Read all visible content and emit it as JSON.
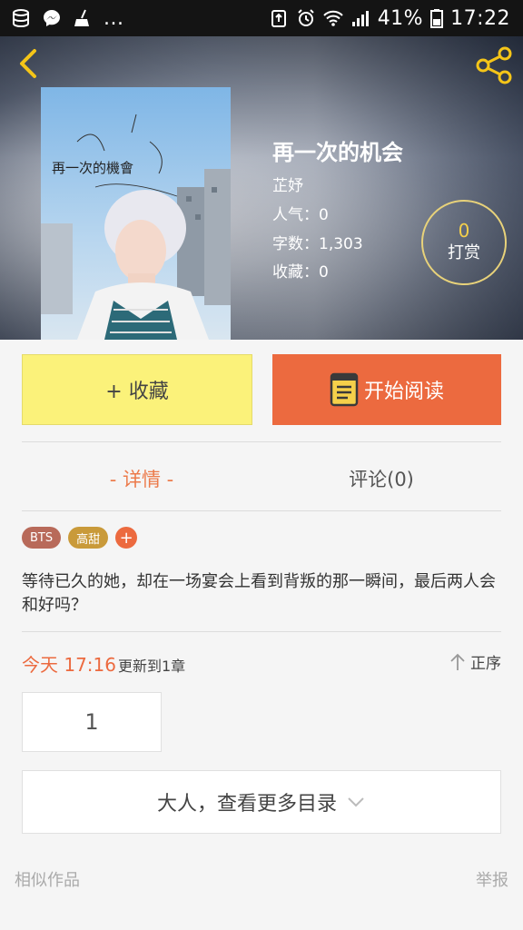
{
  "status_bar": {
    "left_extra": "...",
    "battery_percent": "41%",
    "time": "17:22"
  },
  "book": {
    "title": "再一次的机会",
    "author": "芷妤",
    "popularity": "人气：0",
    "word_count": "字数：1,303",
    "favorites": "收藏：0",
    "cover_handwriting": "再一次的機會"
  },
  "tip": {
    "count": "0",
    "label": "打赏"
  },
  "actions": {
    "collect_label": "+ 收藏",
    "read_label": "开始阅读"
  },
  "tabs": {
    "detail": "- 详情 -",
    "comments": "评论(0)"
  },
  "tags": {
    "items": [
      "BTS",
      "高甜"
    ],
    "add": "+"
  },
  "description": "等待已久的她，却在一场宴会上看到背叛的那一瞬间，最后两人会和好吗？",
  "update": {
    "time": "今天 17:16",
    "chapter": "更新到1章",
    "sort": "正序"
  },
  "chapters": {
    "first": "1",
    "more": "大人，查看更多目录"
  },
  "footer": {
    "similar": "相似作品",
    "report": "举报"
  },
  "colors": {
    "accent": "#ec6a3f",
    "collect_bg": "#fbf27a",
    "tip_ring": "#e8d27a"
  }
}
